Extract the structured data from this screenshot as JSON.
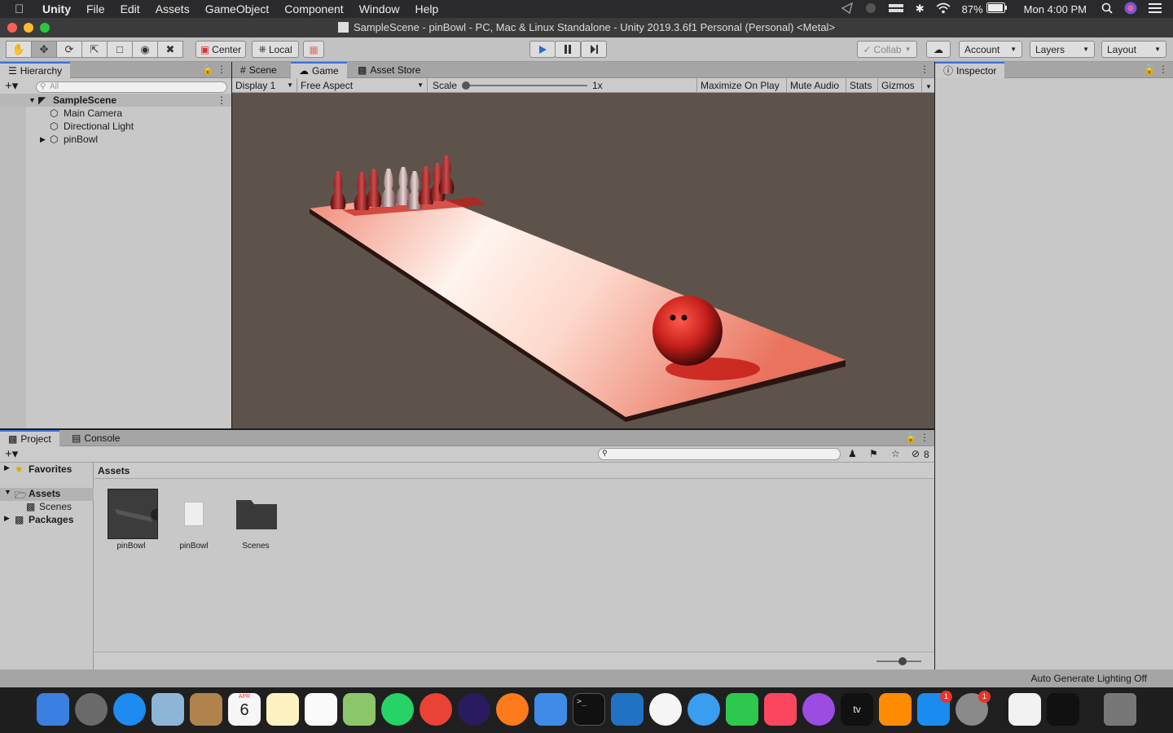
{
  "menubar": {
    "app_name": "Unity",
    "items": [
      "File",
      "Edit",
      "Assets",
      "GameObject",
      "Component",
      "Window",
      "Help"
    ],
    "battery": "87%",
    "clock": "Mon 4:00 PM"
  },
  "window": {
    "title": "SampleScene - pinBowl - PC, Mac & Linux Standalone - Unity 2019.3.6f1 Personal (Personal) <Metal>"
  },
  "toolbar": {
    "pivot_center": "Center",
    "pivot_local": "Local",
    "collab": "Collab",
    "account": "Account",
    "layers": "Layers",
    "layout": "Layout"
  },
  "hierarchy": {
    "tab_label": "Hierarchy",
    "search_placeholder": "All",
    "scene": "SampleScene",
    "objects": [
      "Main Camera",
      "Directional Light",
      "pinBowl"
    ]
  },
  "center_tabs": {
    "scene": "Scene",
    "game": "Game",
    "asset_store": "Asset Store"
  },
  "game_bar": {
    "display": "Display 1",
    "aspect": "Free Aspect",
    "scale_label": "Scale",
    "scale_value": "1x",
    "maximize": "Maximize On Play",
    "mute": "Mute Audio",
    "stats": "Stats",
    "gizmos": "Gizmos"
  },
  "inspector": {
    "tab_label": "Inspector"
  },
  "project": {
    "tab_project": "Project",
    "tab_console": "Console",
    "hidden_count": "8",
    "tree": [
      "Favorites",
      "Assets",
      "Scenes",
      "Packages"
    ],
    "breadcrumb": "Assets",
    "assets": [
      {
        "name": "pinBowl",
        "kind": "prefab"
      },
      {
        "name": "pinBowl",
        "kind": "file"
      },
      {
        "name": "Scenes",
        "kind": "folder"
      }
    ]
  },
  "status": {
    "lighting": "Auto Generate Lighting Off"
  },
  "dock": {
    "calendar_month": "APR",
    "calendar_day": "6",
    "badge_appstore": "1",
    "badge_settings": "1",
    "tv_label": "tv"
  },
  "colors": {
    "accent_blue": "#3a72d8",
    "lane_red": "#e0644f",
    "game_bg": "#5d534a"
  }
}
